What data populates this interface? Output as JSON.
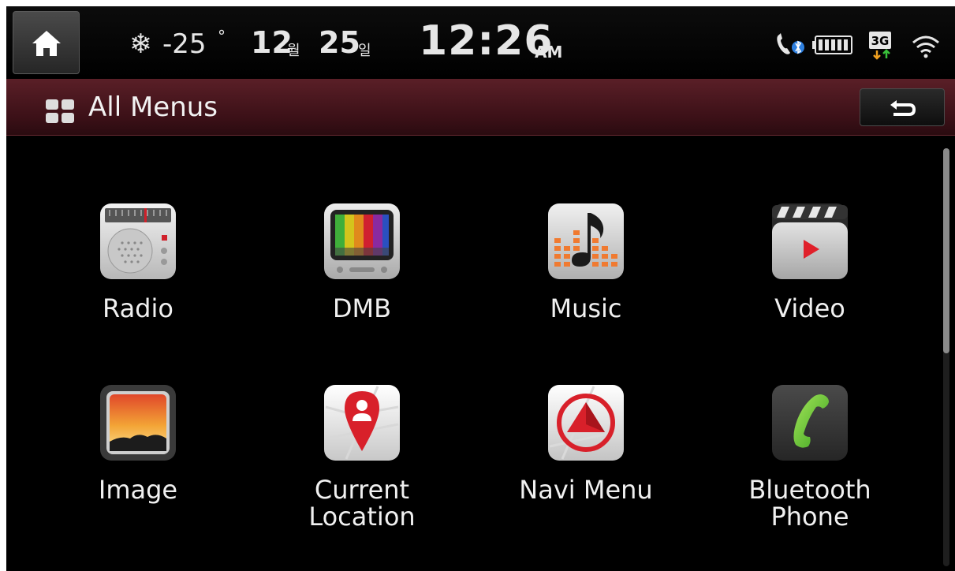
{
  "status": {
    "snow_glyph": "❄",
    "temperature": "-25",
    "degree": "°",
    "month": "12",
    "month_unit": "월",
    "day": "25",
    "day_unit": "일",
    "time": "12:26",
    "ampm": "AM",
    "network": "3G"
  },
  "header": {
    "title": "All Menus"
  },
  "menu": [
    {
      "label_lines": [
        "Radio"
      ],
      "icon": "radio-icon"
    },
    {
      "label_lines": [
        "DMB"
      ],
      "icon": "tv-icon"
    },
    {
      "label_lines": [
        "Music"
      ],
      "icon": "music-note-icon"
    },
    {
      "label_lines": [
        "Video"
      ],
      "icon": "clapperboard-icon"
    },
    {
      "label_lines": [
        "Image"
      ],
      "icon": "landscape-photo-icon"
    },
    {
      "label_lines": [
        "Current",
        "Location"
      ],
      "icon": "map-pin-icon"
    },
    {
      "label_lines": [
        "Navi Menu"
      ],
      "icon": "navigation-arrow-icon"
    },
    {
      "label_lines": [
        "Bluetooth",
        "Phone"
      ],
      "icon": "phone-handset-icon"
    }
  ],
  "colors": {
    "title_bar": "#4a1720",
    "background": "#000000",
    "text": "#f0f0f0"
  }
}
